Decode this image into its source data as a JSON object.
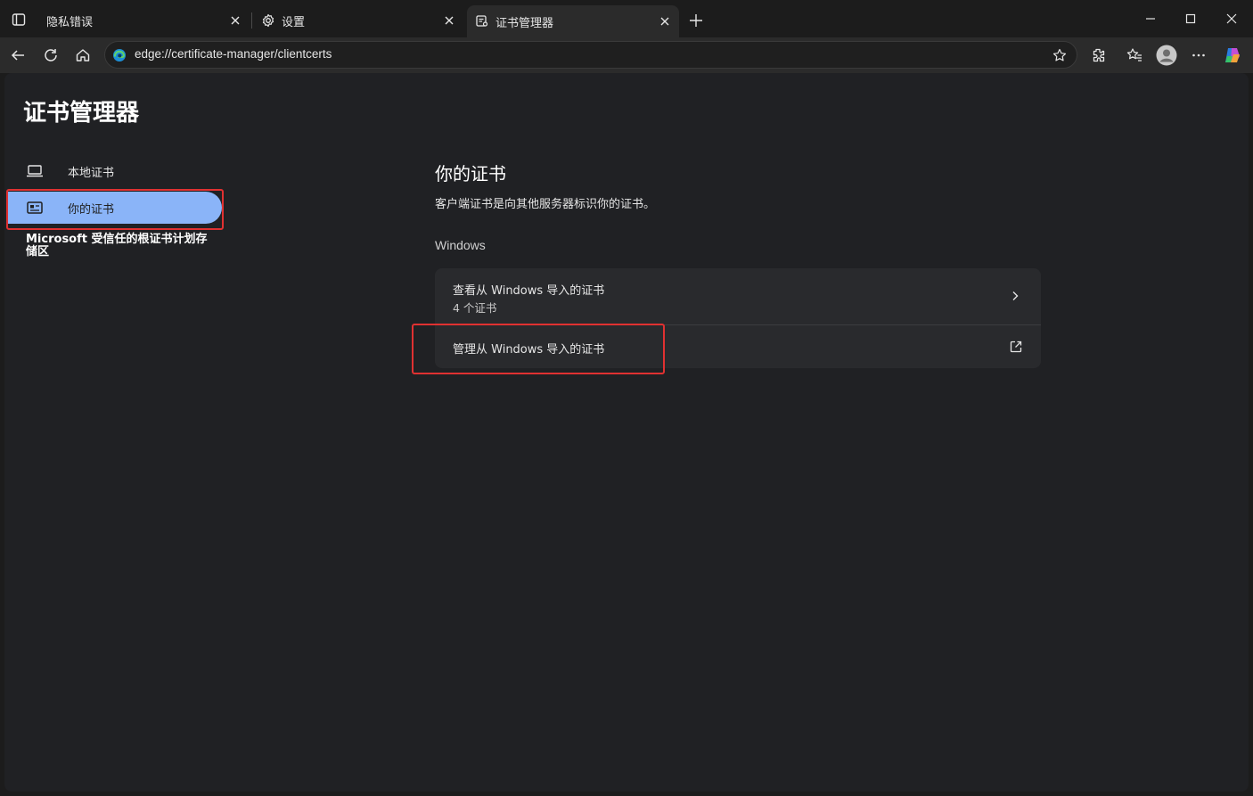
{
  "tabs": [
    {
      "title": "隐私错误",
      "icon": "tab-page-icon",
      "close": "×"
    },
    {
      "title": "设置",
      "icon": "gear-icon",
      "close": "×"
    },
    {
      "title": "证书管理器",
      "icon": "certificate-icon",
      "close": "×"
    }
  ],
  "toolbar": {
    "url": "edge://certificate-manager/clientcerts"
  },
  "page": {
    "title": "证书管理器",
    "nav": {
      "local": "本地证书",
      "yours": "你的证书",
      "microsoft": "Microsoft 受信任的根证书计划存储区"
    },
    "section": {
      "title": "你的证书",
      "description": "客户端证书是向其他服务器标识你的证书。",
      "subheading": "Windows",
      "view_imported": {
        "title": "查看从 Windows 导入的证书",
        "count": "4 个证书"
      },
      "manage_imported": {
        "title": "管理从 Windows 导入的证书"
      }
    }
  },
  "colors": {
    "accent": "#8ab4f8",
    "highlight": "#e03131",
    "page_bg": "#202124",
    "card_bg": "#292a2d"
  }
}
